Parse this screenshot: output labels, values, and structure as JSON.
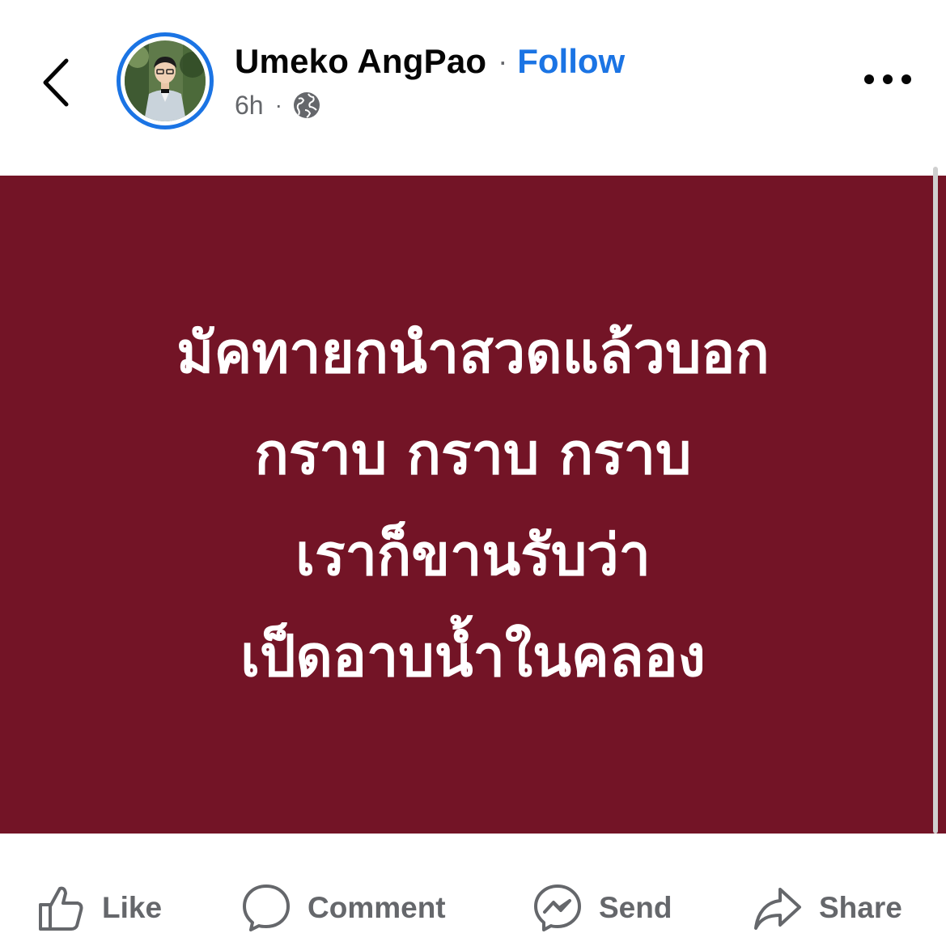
{
  "header": {
    "author": "Umeko AngPao",
    "separator": "·",
    "follow_label": "Follow",
    "time": "6h",
    "meta_separator": "·",
    "privacy_icon": "globe-icon",
    "back_icon": "chevron-left-icon",
    "more_icon": "more-horizontal-icon"
  },
  "post": {
    "background_color": "#731426",
    "lines": [
      "มัคทายกนำสวดแล้วบอก",
      "กราบ กราบ กราบ",
      "เราก็ขานรับว่า",
      "เป็ดอาบน้ำในคลอง"
    ]
  },
  "actions": {
    "like": "Like",
    "comment": "Comment",
    "send": "Send",
    "share": "Share"
  },
  "colors": {
    "accent": "#1b74e4",
    "text_secondary": "#65676b"
  }
}
